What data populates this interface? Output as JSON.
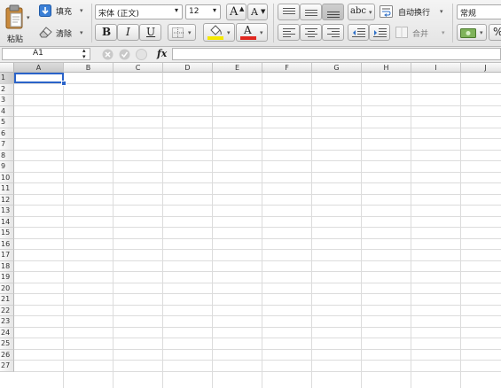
{
  "toolbar": {
    "paste_label": "粘贴",
    "fill_label": "填充",
    "clear_label": "清除",
    "font_name": "宋体 (正文)",
    "font_size": "12",
    "grow_font": "A",
    "shrink_font": "A",
    "bold": "B",
    "italic": "I",
    "underline": "U",
    "font_color_letter": "A",
    "orientation_label": "abc",
    "wrap_text_label": "自动换行",
    "merge_label": "合并",
    "number_format": "常规",
    "percent": "%"
  },
  "formula_bar": {
    "name_box": "A1",
    "fx": "fx",
    "value": ""
  },
  "sheet": {
    "columns": [
      "A",
      "B",
      "C",
      "D",
      "E",
      "F",
      "G",
      "H",
      "I",
      "J"
    ],
    "rows": [
      "1",
      "2",
      "3",
      "4",
      "5",
      "6",
      "7",
      "8",
      "9",
      "10",
      "11",
      "12",
      "13",
      "14",
      "15",
      "16",
      "17",
      "18",
      "19",
      "20",
      "21",
      "22",
      "23",
      "24",
      "25",
      "26",
      "27"
    ],
    "selected_cell": "A1"
  },
  "colors": {
    "fill_color": "#f5e800",
    "font_color": "#e0271f",
    "selection": "#2a63c9"
  }
}
